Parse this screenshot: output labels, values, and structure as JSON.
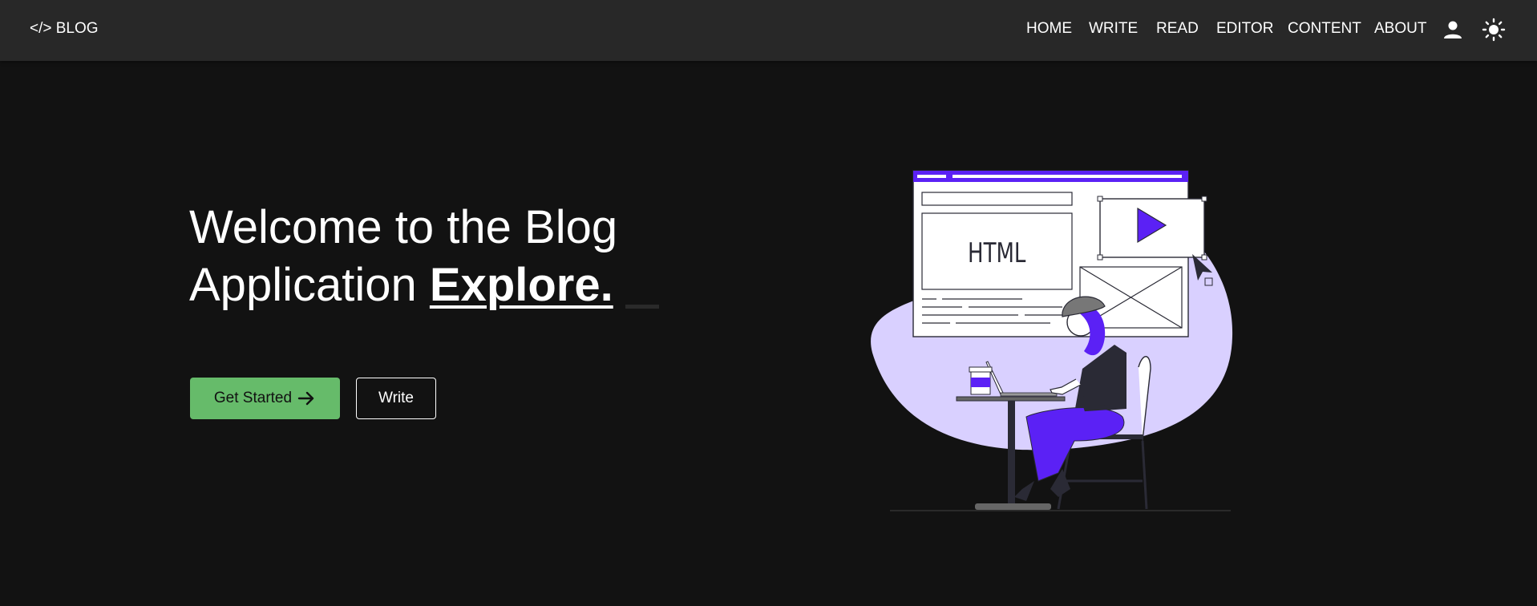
{
  "header": {
    "brand": "</> BLOG",
    "nav": [
      "HOME",
      "WRITE",
      "READ",
      "EDITOR",
      "CONTENT",
      "ABOUT"
    ],
    "icons": [
      "user-icon",
      "sun-icon"
    ]
  },
  "hero": {
    "title_line1": "Welcome to the Blog",
    "title_line2": "Application",
    "title_emphasis": "Explore.",
    "primary_button": "Get Started",
    "secondary_button": "Write"
  },
  "illustration": {
    "html_label": "HTML"
  },
  "colors": {
    "background": "#121212",
    "header": "#282828",
    "primary_button": "#66bb6a",
    "accent_purple": "#5b21f5",
    "blob_lavender": "#d9d0ff"
  }
}
